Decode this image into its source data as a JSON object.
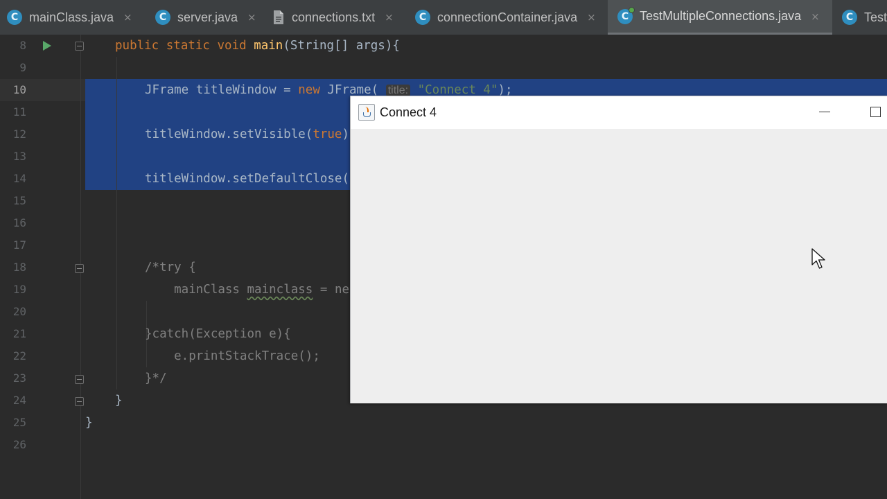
{
  "tabs": [
    {
      "label": "mainClass.java",
      "icon": "java-class-icon",
      "active": false
    },
    {
      "label": "server.java",
      "icon": "java-class-icon",
      "active": false
    },
    {
      "label": "connections.txt",
      "icon": "text-file-icon",
      "active": false
    },
    {
      "label": "connectionContainer.java",
      "icon": "java-class-icon",
      "active": false
    },
    {
      "label": "TestMultipleConnections.java",
      "icon": "java-class-icon",
      "active": true
    },
    {
      "label": "Test",
      "icon": "java-class-icon",
      "active": false
    }
  ],
  "tab_icon_glyph": "C",
  "close_glyph": "×",
  "editor": {
    "line_numbers": [
      "8",
      "9",
      "10",
      "11",
      "12",
      "13",
      "14",
      "15",
      "16",
      "17",
      "18",
      "19",
      "20",
      "21",
      "22",
      "23",
      "24",
      "25",
      "26"
    ],
    "current_line": "10",
    "lines": {
      "l8": {
        "kw1": "public static void ",
        "fn": "main",
        "rest": "(String[] args){"
      },
      "l10": {
        "t1": "JFrame titleWindow = ",
        "kw": "new",
        "t2": " JFrame( ",
        "hint": "title:",
        "str": " \"Connect 4\"",
        "t3": ");"
      },
      "l12": {
        "t1": "titleWindow.setVisible(",
        "kw": "true",
        "t2": ")"
      },
      "l14": {
        "t1": "titleWindow.setDefaultClose("
      },
      "l18": {
        "cmt": "/*try {"
      },
      "l19": {
        "cmt1": "    mainClass ",
        "cmt_warn": "mainclass",
        "cmt2": " = ne"
      },
      "l21": {
        "cmt": "}catch(Exception e){"
      },
      "l22": {
        "cmt": "    e.printStackTrace();"
      },
      "l23": {
        "cmt": "}*/"
      },
      "l24": {
        "t": "}"
      },
      "l25": {
        "t": "}"
      }
    }
  },
  "jframe": {
    "title": "Connect 4",
    "icon": "java-cup-icon"
  },
  "colors": {
    "editor_bg": "#2b2b2b",
    "selection": "#214283",
    "keyword": "#cc7832",
    "function": "#ffc66d",
    "string": "#6a8759",
    "comment": "#808080"
  }
}
